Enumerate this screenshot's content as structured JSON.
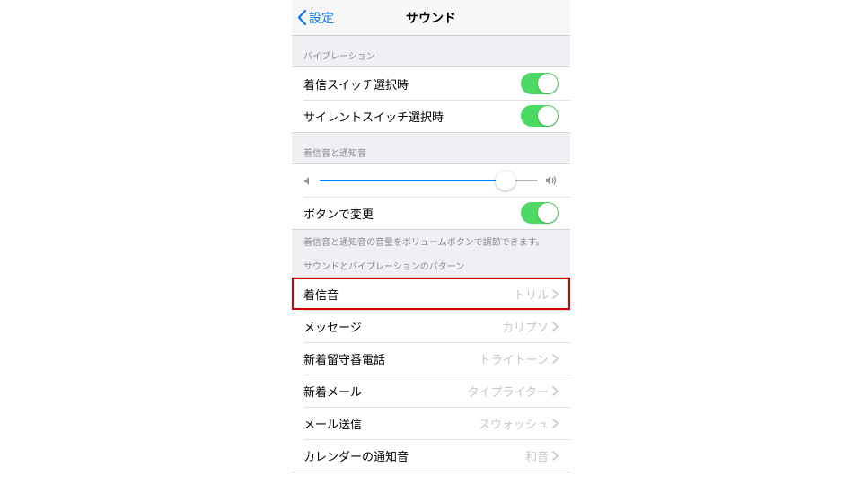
{
  "nav": {
    "back": "設定",
    "title": "サウンド"
  },
  "sections": {
    "vibration": {
      "header": "バイブレーション",
      "ringSwitch": "着信スイッチ選択時",
      "silentSwitch": "サイレントスイッチ選択時"
    },
    "ringer": {
      "header": "着信音と通知音",
      "volumePercent": 85,
      "buttonChange": "ボタンで変更",
      "footer": "着信音と通知音の音量をボリュームボタンで調節できます。"
    },
    "patterns": {
      "header": "サウンドとバイブレーションのパターン",
      "items": [
        {
          "label": "着信音",
          "value": "トリル",
          "highlight": true
        },
        {
          "label": "メッセージ",
          "value": "カリプソ"
        },
        {
          "label": "新着留守番電話",
          "value": "トライトーン"
        },
        {
          "label": "新着メール",
          "value": "タイプライター"
        },
        {
          "label": "メール送信",
          "value": "スウォッシュ"
        },
        {
          "label": "カレンダーの通知音",
          "value": "和音"
        }
      ]
    }
  }
}
